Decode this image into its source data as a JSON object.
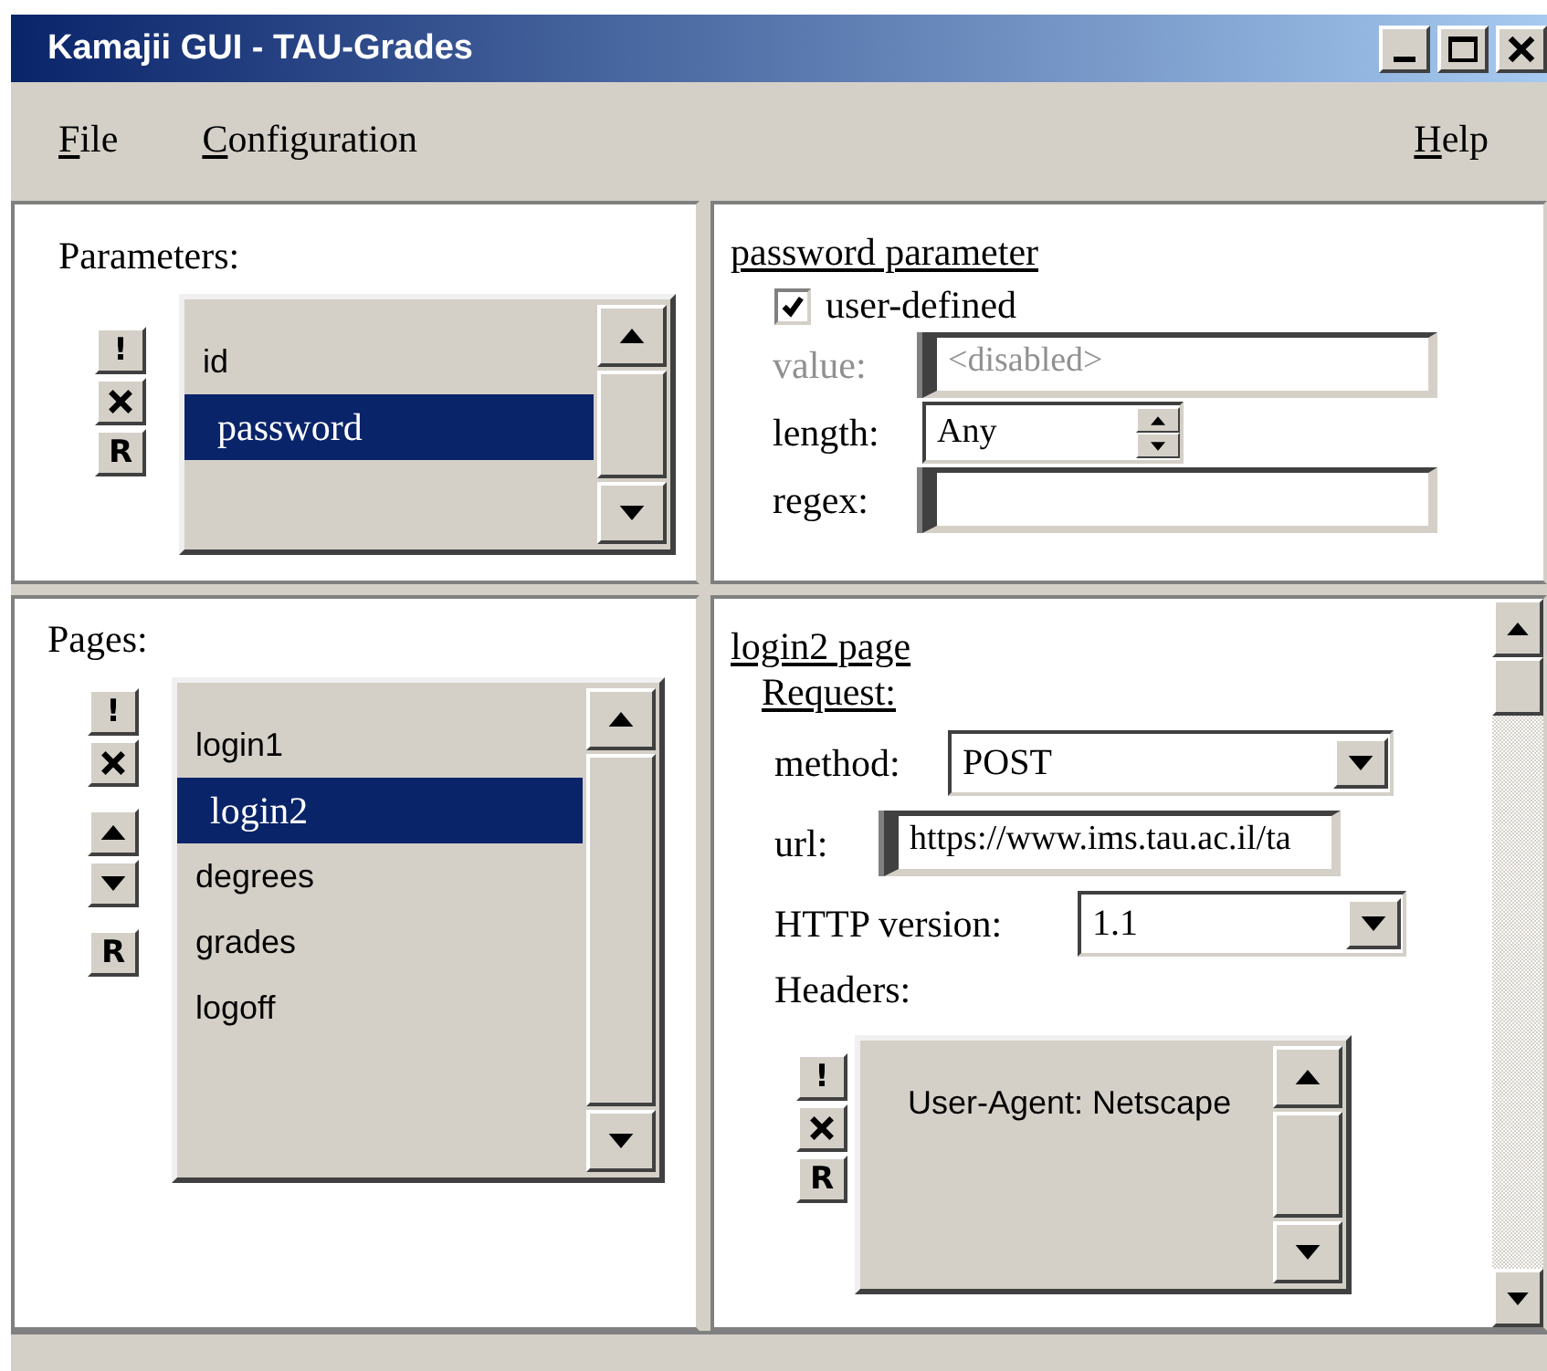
{
  "window": {
    "title": "Kamajii GUI - TAU-Grades"
  },
  "menu": [
    {
      "label": "File",
      "mnemonic": true
    },
    {
      "label": "Configuration",
      "mnemonic": true
    },
    {
      "label": "Help",
      "mnemonic": true
    }
  ],
  "parameters": {
    "title": "Parameters:",
    "tools": [
      [
        {
          "kind": "label",
          "label": "!"
        },
        {
          "kind": "remove"
        },
        {
          "kind": "label",
          "label": "R"
        }
      ]
    ],
    "items": [
      {
        "label": "id",
        "selected": false
      },
      {
        "label": "password",
        "selected": true
      }
    ]
  },
  "parameter_detail": {
    "title": "password parameter",
    "user_defined": {
      "label": "user-defined",
      "checked": true
    },
    "fields": [
      {
        "kind": "text",
        "label": "value:",
        "value": "<disabled>",
        "disabled": true
      },
      {
        "kind": "spinner",
        "label": "length:",
        "value": "Any"
      },
      {
        "kind": "text",
        "label": "regex:"
      }
    ]
  },
  "pages": {
    "title": "Pages:",
    "tools": [
      [
        {
          "kind": "label",
          "label": "!"
        },
        {
          "kind": "remove"
        }
      ],
      [
        {
          "kind": "up"
        },
        {
          "kind": "down"
        }
      ],
      [
        {
          "kind": "label",
          "label": "R"
        }
      ]
    ],
    "items": [
      {
        "label": "login1",
        "selected": false
      },
      {
        "label": "login2",
        "selected": true
      },
      {
        "label": "degrees",
        "selected": false
      },
      {
        "label": "grades",
        "selected": false
      },
      {
        "label": "logoff",
        "selected": false
      }
    ]
  },
  "page_detail": {
    "title": "login2 page",
    "section": "Request:",
    "fields": [
      {
        "kind": "select",
        "label": "method:",
        "value": "POST"
      },
      {
        "kind": "text",
        "label": "url:",
        "value": "https://www.ims.tau.ac.il/ta"
      },
      {
        "kind": "select",
        "label": "HTTP version:",
        "value": "1.1"
      }
    ],
    "headers": {
      "title": "Headers:",
      "tools": [
        [
          {
            "kind": "label",
            "label": "!"
          },
          {
            "kind": "remove"
          },
          {
            "kind": "label",
            "label": "R"
          }
        ]
      ],
      "items": [
        {
          "label": "User-Agent: Netscape",
          "selected": false
        }
      ]
    }
  }
}
